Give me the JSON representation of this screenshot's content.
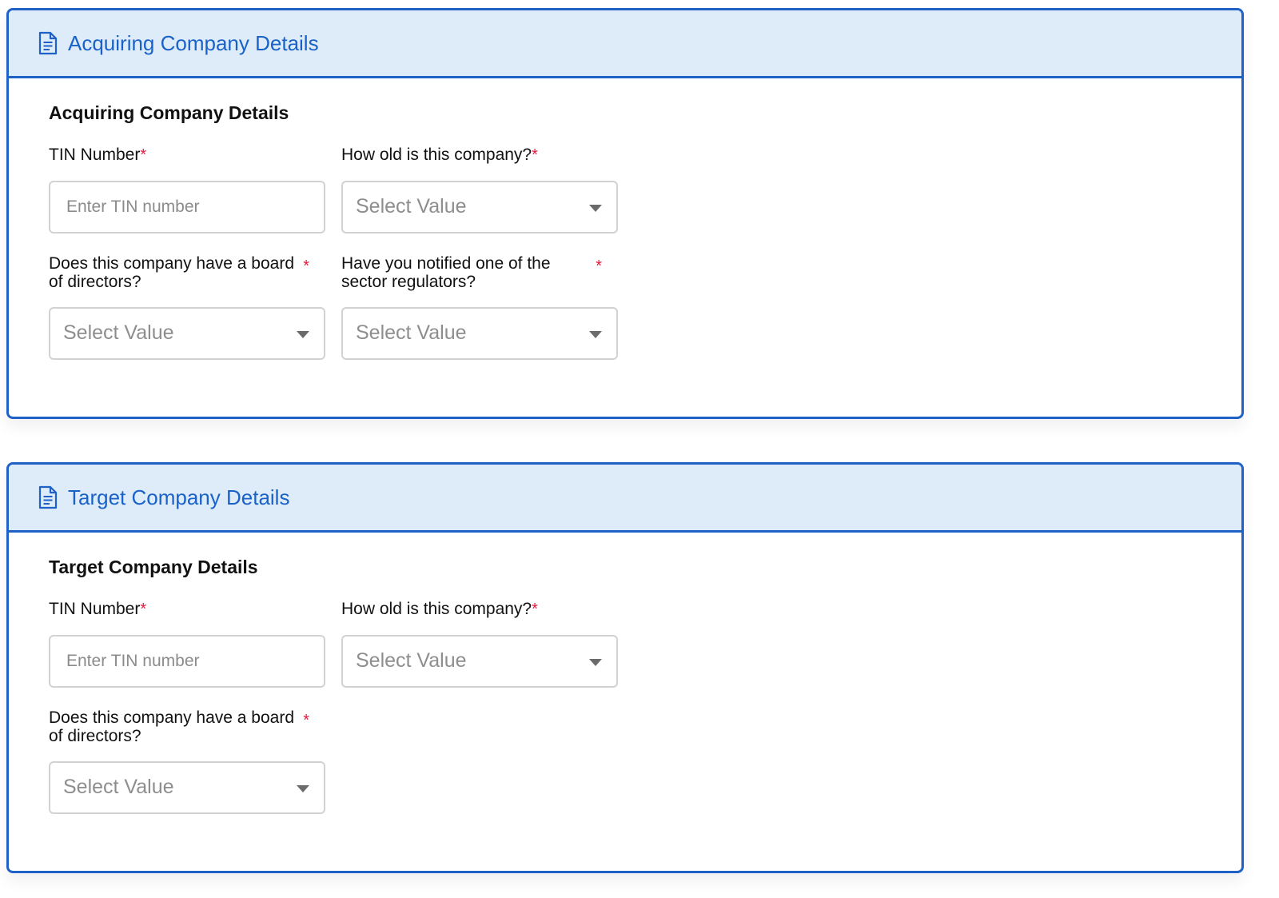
{
  "sections": [
    {
      "header_title": "Acquiring Company Details",
      "section_title": "Acquiring Company Details",
      "tin": {
        "label": "TIN Number",
        "required_mark": "*",
        "placeholder": "Enter TIN number"
      },
      "age": {
        "label": "How old is this company?",
        "required_mark": "*",
        "value": "Select Value"
      },
      "board": {
        "label": "Does this company have a board of directors?",
        "required_mark": "*",
        "value": "Select Value"
      },
      "regulator": {
        "label": "Have you notified one of the sector regulators?",
        "required_mark": "*",
        "value": "Select Value"
      }
    },
    {
      "header_title": "Target Company Details",
      "section_title": "Target Company Details",
      "tin": {
        "label": "TIN Number",
        "required_mark": "*",
        "placeholder": "Enter TIN number"
      },
      "age": {
        "label": "How old is this company?",
        "required_mark": "*",
        "value": "Select Value"
      },
      "board": {
        "label": "Does this company have a board of directors?",
        "required_mark": "*",
        "value": "Select Value"
      }
    }
  ],
  "icons": {
    "header_icon": "document-icon",
    "dropdown_icon": "caret-down-icon"
  },
  "colors": {
    "accent": "#1f62c7",
    "header_bg": "#deebf8",
    "required": "#e21b3c",
    "input_border": "#d2d2d2",
    "placeholder": "#8e8e8e"
  }
}
